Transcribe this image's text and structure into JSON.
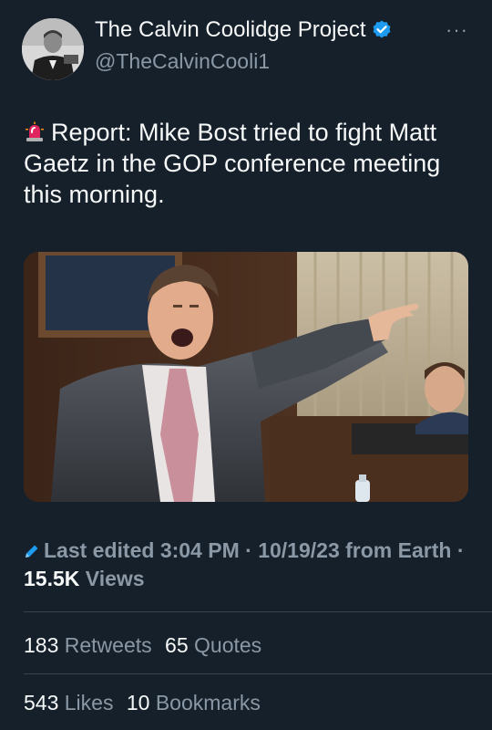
{
  "author": {
    "name": "The Calvin Coolidge Project",
    "handle": "@TheCalvinCooli1",
    "verified_icon": "verified-badge-icon",
    "verified_color": "#1d9bf0"
  },
  "more_label": "···",
  "tweet": {
    "emoji": "rotating-light-icon",
    "text": "Report: Mike Bost tried to fight Matt Gaetz in the GOP conference meeting this morning."
  },
  "meta": {
    "edited_label": "Last edited",
    "time": "3:04 PM",
    "separator": "·",
    "date": "10/19/23",
    "from": "from",
    "location": "Earth",
    "views_count": "15.5K",
    "views_label": "Views"
  },
  "stats": {
    "retweets_count": "183",
    "retweets_label": "Retweets",
    "quotes_count": "65",
    "quotes_label": "Quotes",
    "likes_count": "543",
    "likes_label": "Likes",
    "bookmarks_count": "10",
    "bookmarks_label": "Bookmarks"
  },
  "colors": {
    "background": "#15202b",
    "primary_text": "#f7f9f9",
    "secondary_text": "#8b98a5",
    "divider": "#38444d",
    "accent_blue": "#1d9bf0"
  }
}
